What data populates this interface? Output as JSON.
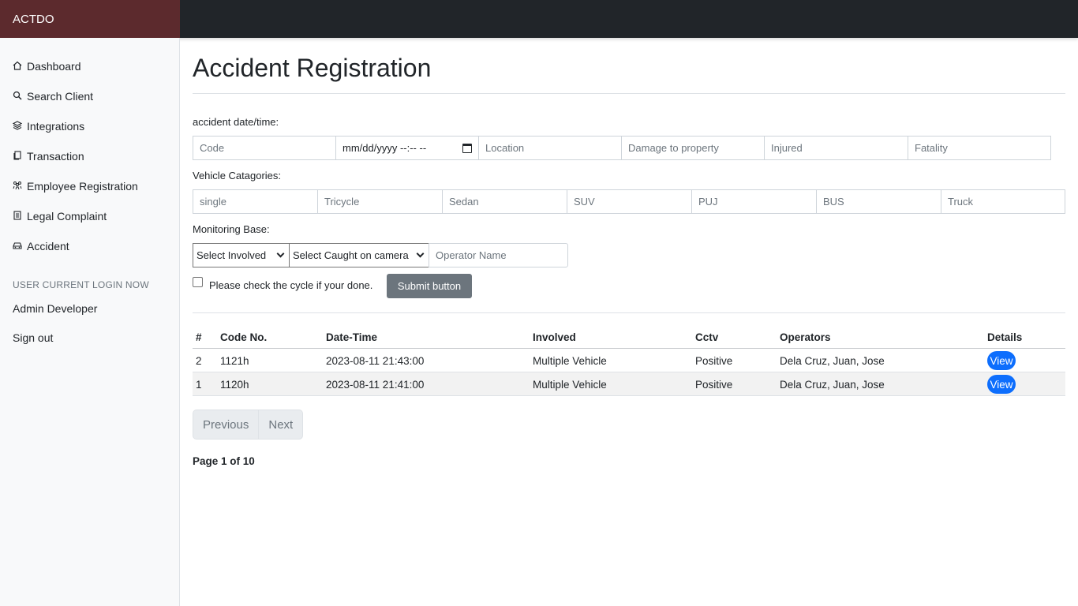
{
  "brand": "ACTDO",
  "sidebar": {
    "items": [
      {
        "label": "Dashboard",
        "icon": "house-icon"
      },
      {
        "label": "Search Client",
        "icon": "search-icon"
      },
      {
        "label": "Integrations",
        "icon": "layers-icon"
      },
      {
        "label": "Transaction",
        "icon": "documents-icon"
      },
      {
        "label": "Employee Registration",
        "icon": "people-icon"
      },
      {
        "label": "Legal Complaint",
        "icon": "document-icon"
      },
      {
        "label": "Accident",
        "icon": "car-icon"
      }
    ],
    "heading": "USER CURRENT LOGIN NOW",
    "user": "Admin Developer",
    "signout": "Sign out"
  },
  "main": {
    "title": "Accident Registration",
    "date_label": "accident date/time:",
    "fields": {
      "code": "Code",
      "datetime": "mm/dd/yyyy --:-- --",
      "location": "Location",
      "damage": "Damage to property",
      "injured": "Injured",
      "fatality": "Fatality"
    },
    "vehicle_label": "Vehicle Catagories:",
    "vehicles": [
      "single",
      "Tricycle",
      "Sedan",
      "SUV",
      "PUJ",
      "BUS",
      "Truck"
    ],
    "monitoring_label": "Monitoring Base:",
    "select_involved": "Select Involved",
    "select_camera": "Select Caught on camera",
    "operator_placeholder": "Operator Name",
    "checkbox_label": "Please check the cycle if your done.",
    "submit": "Submit button",
    "table": {
      "headers": [
        "#",
        "Code No.",
        "Date-Time",
        "Involved",
        "Cctv",
        "Operators",
        "Details"
      ],
      "rows": [
        {
          "num": "2",
          "code": "1121h",
          "datetime": "2023-08-11 21:43:00",
          "involved": "Multiple Vehicle",
          "cctv": "Positive",
          "operators": "Dela Cruz, Juan, Jose",
          "details": "View"
        },
        {
          "num": "1",
          "code": "1120h",
          "datetime": "2023-08-11 21:41:00",
          "involved": "Multiple Vehicle",
          "cctv": "Positive",
          "operators": "Dela Cruz, Juan, Jose",
          "details": "View"
        }
      ]
    },
    "pager": {
      "prev": "Previous",
      "next": "Next"
    },
    "page_info": "Page 1 of 10"
  },
  "colors": {
    "brand_bg": "#5c2a2d",
    "topbar_bg": "#212529",
    "primary": "#0d6efd",
    "secondary": "#6c757d"
  }
}
